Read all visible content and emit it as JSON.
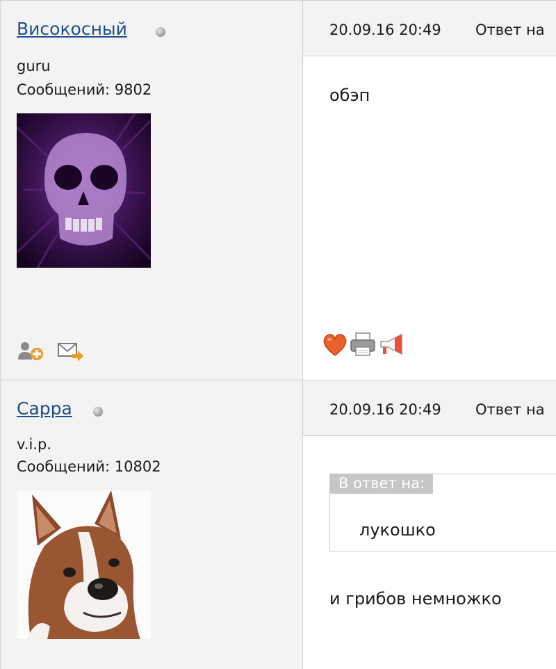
{
  "posts": [
    {
      "author": {
        "name": "Високосный",
        "rank": "guru",
        "messages": "Сообщений: 9802",
        "avatar_icon": "purple-skull-image"
      },
      "date": "20.09.16 20:49",
      "reply_label": "Ответ на",
      "text": "обэп",
      "action_icons": [
        "add-friend-icon",
        "send-message-icon"
      ],
      "post_icons": [
        "heart-icon",
        "print-icon",
        "megaphone-icon"
      ]
    },
    {
      "author": {
        "name": "Сарра",
        "rank": "v.i.p.",
        "messages": "Сообщений: 10802",
        "avatar_icon": "boxer-dog-image"
      },
      "date": "20.09.16 20:49",
      "reply_label": "Ответ на",
      "quote": {
        "label": "В ответ на:",
        "text": "лукошко"
      },
      "text": "и грибов немножко"
    }
  ],
  "colors": {
    "link": "#1f4f86",
    "panel": "#f3f3f3",
    "border": "#cfcfcf",
    "quote_label_bg": "#c6c6c6"
  }
}
